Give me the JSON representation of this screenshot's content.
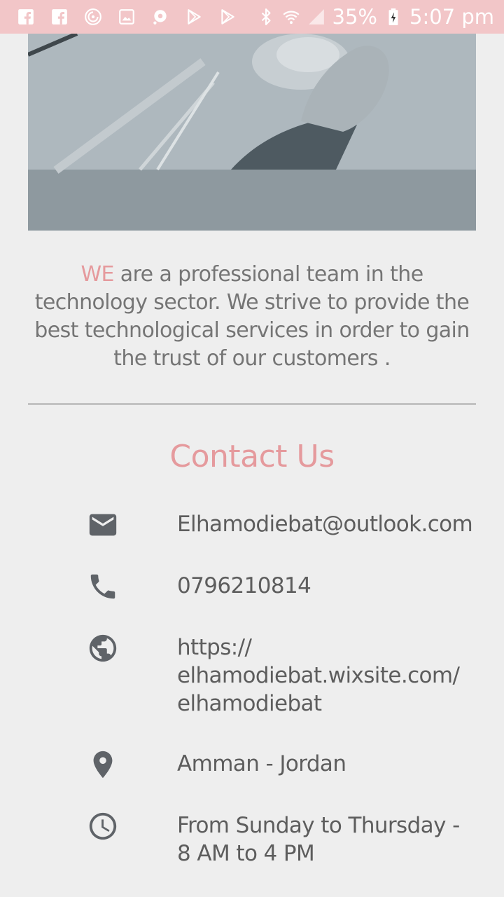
{
  "status_bar": {
    "battery": "35%",
    "time": "5:07 pm",
    "left_icons": [
      "facebook-icon",
      "facebook-icon",
      "sync-icon",
      "image-icon",
      "app-icon",
      "play-store-icon",
      "play-store-icon"
    ],
    "right_icons": [
      "bluetooth-icon",
      "wifi-icon",
      "signal-icon",
      "battery-charging-icon"
    ]
  },
  "about": {
    "highlight": "WE",
    "text": " are a professional team in the technology sector. We strive to provide the best technological services in order to gain the trust of our customers ."
  },
  "contact": {
    "title": "Contact Us",
    "email": "Elhamodiebat@outlook.com",
    "phone": "0796210814",
    "website_line1": "https://",
    "website_line2": "elhamodiebat.wixsite.com/",
    "website_line3": "elhamodiebat",
    "location": "Amman - Jordan",
    "hours_line1": "From Sunday to Thursday -",
    "hours_line2": "8 AM to 4 PM"
  },
  "colors": {
    "accent": "#e59a9d",
    "status_bar": "#f2c6c8",
    "background": "#eeeeee",
    "icon": "#5f6368",
    "text": "#5d5d5d"
  }
}
